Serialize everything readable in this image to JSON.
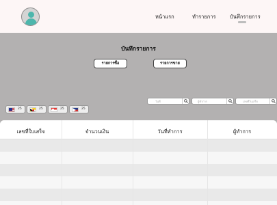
{
  "header": {
    "avatar_icon": "user-avatar-icon",
    "nav": [
      {
        "label": "หน้าแรก"
      },
      {
        "label": "ทำรายการ"
      },
      {
        "label": "บันทึกรายการ"
      }
    ]
  },
  "page": {
    "title": "บันทึกรายการ",
    "buttons": {
      "buy": "รายการซื้อ",
      "sell": "รายการขาย"
    }
  },
  "search": [
    {
      "placeholder": "วันที่"
    },
    {
      "placeholder": "ผู้ทำการ"
    },
    {
      "placeholder": "เลขที่ใบเสร็จ"
    }
  ],
  "currencies": [
    {
      "flag": "us-flag-icon",
      "value": "25"
    },
    {
      "flag": "brunei-flag-icon",
      "value": "25"
    },
    {
      "flag": "singapore-flag-icon",
      "value": "25"
    },
    {
      "flag": "philippines-flag-icon",
      "value": "25"
    }
  ],
  "table": {
    "headers": [
      "เลขที่ใบเสร็จ",
      "จำนวนเงิน",
      "วันที่ทำการ",
      "ผู้ทำการ"
    ]
  },
  "colors": {
    "band": "#b3b1b1",
    "row_alt": "#e9e9e9"
  }
}
